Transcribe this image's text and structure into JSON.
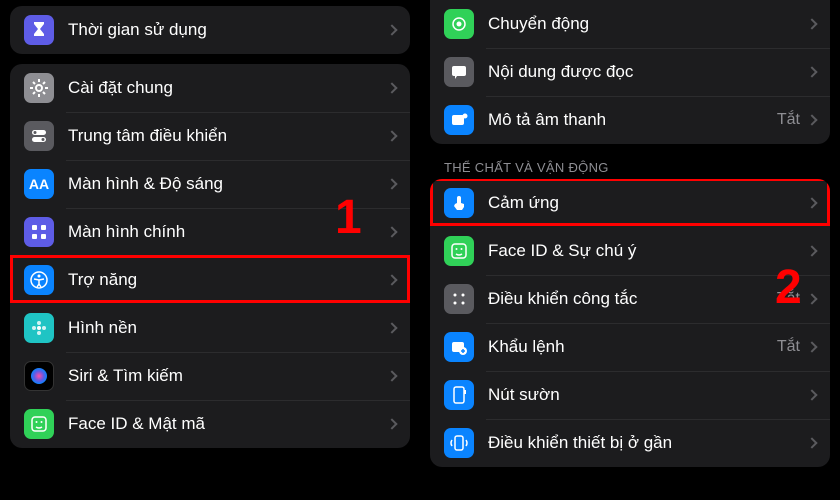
{
  "left": {
    "top_group": [
      {
        "icon": "hourglass",
        "bg": "bg-purple",
        "label": "Thời gian sử dụng"
      }
    ],
    "main_group": [
      {
        "icon": "gear",
        "bg": "bg-gray",
        "label": "Cài đặt chung"
      },
      {
        "icon": "toggles",
        "bg": "bg-gray2",
        "label": "Trung tâm điều khiển"
      },
      {
        "icon": "aa",
        "bg": "bg-blue",
        "label": "Màn hình & Độ sáng"
      },
      {
        "icon": "grid",
        "bg": "bg-purple",
        "label": "Màn hình chính"
      },
      {
        "icon": "accessibility",
        "bg": "bg-blue",
        "label": "Trợ năng",
        "highlighted": true
      },
      {
        "icon": "flower",
        "bg": "bg-teal",
        "label": "Hình nền"
      },
      {
        "icon": "siri",
        "bg": "bg-black",
        "label": "Siri & Tìm kiếm"
      },
      {
        "icon": "faceid",
        "bg": "bg-green",
        "label": "Face ID & Mật mã"
      }
    ]
  },
  "right": {
    "top_group": [
      {
        "icon": "motion",
        "bg": "bg-green",
        "label": "Chuyển động"
      },
      {
        "icon": "speech",
        "bg": "bg-gray2",
        "label": "Nội dung được đọc"
      },
      {
        "icon": "audio",
        "bg": "bg-blue",
        "label": "Mô tả âm thanh",
        "value": "Tắt"
      }
    ],
    "section_title": "THỂ CHẤT VÀ VẬN ĐỘNG",
    "main_group": [
      {
        "icon": "touch",
        "bg": "bg-blue",
        "label": "Cảm ứng",
        "highlighted": true
      },
      {
        "icon": "faceid",
        "bg": "bg-green",
        "label": "Face ID & Sự chú ý"
      },
      {
        "icon": "switch",
        "bg": "bg-gray2",
        "label": "Điều khiển công tắc",
        "value": "Tắt"
      },
      {
        "icon": "voice",
        "bg": "bg-blue",
        "label": "Khẩu lệnh",
        "value": "Tắt"
      },
      {
        "icon": "sidebtn",
        "bg": "bg-blue",
        "label": "Nút sườn"
      },
      {
        "icon": "nearby",
        "bg": "bg-blue",
        "label": "Điều khiển thiết bị ở gần"
      }
    ]
  },
  "annotations": {
    "one": "1",
    "two": "2"
  }
}
